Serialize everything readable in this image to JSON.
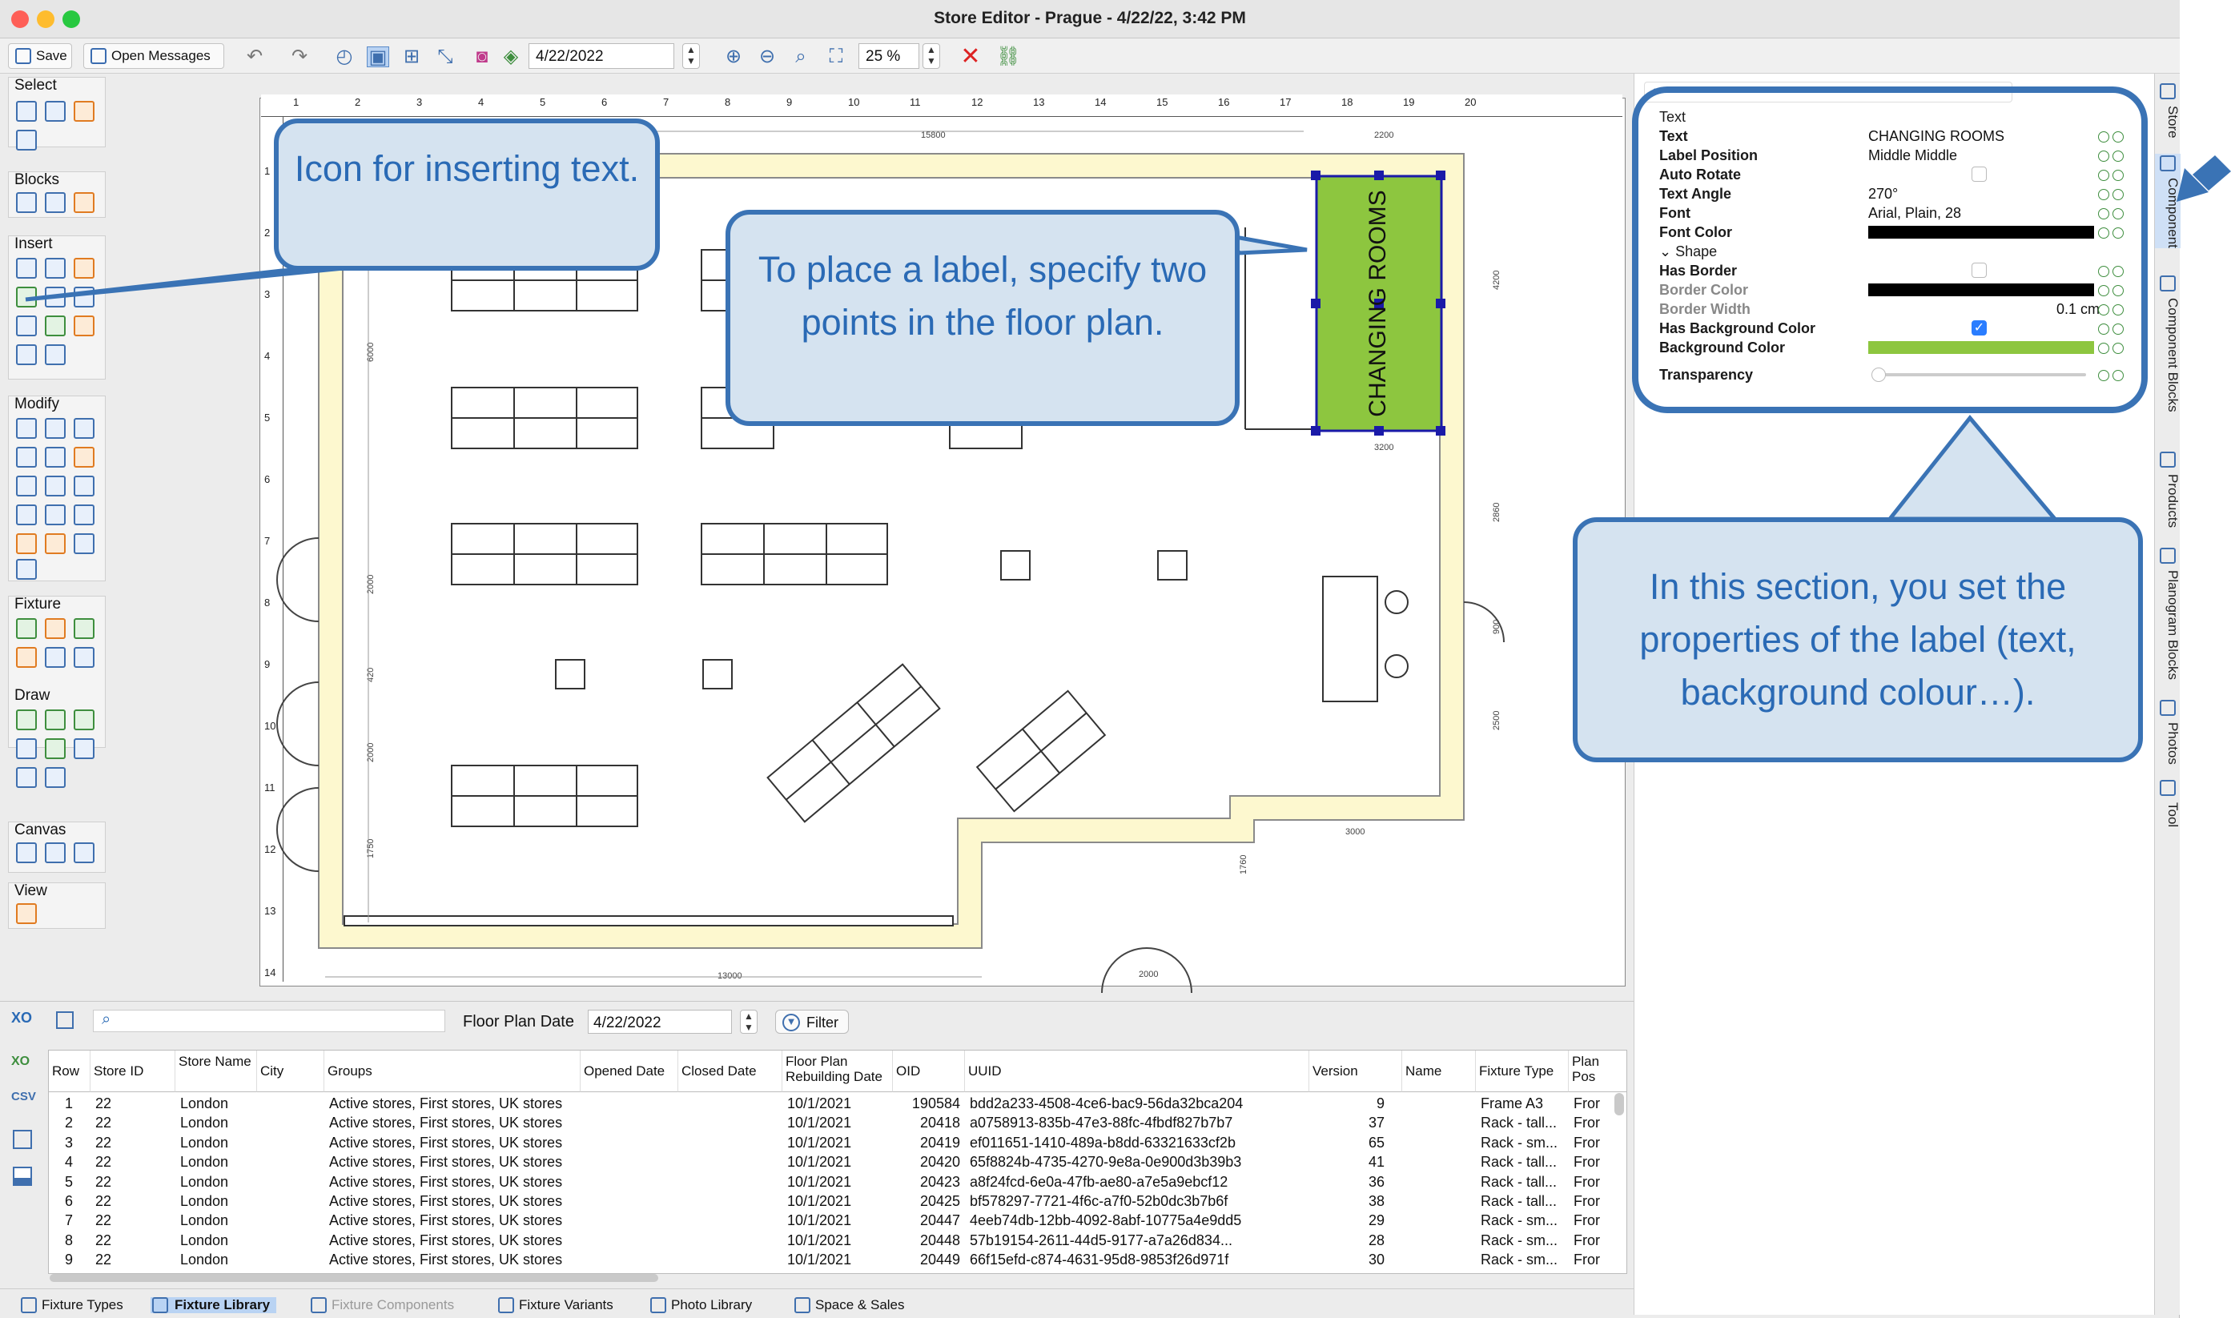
{
  "window": {
    "title": "Store Editor - Prague - 4/22/22, 3:42 PM"
  },
  "toolbar": {
    "save_label": "Save",
    "messages_label": "Open Messages",
    "date_value": "4/22/2022",
    "zoom_value": "25 %"
  },
  "palette": {
    "groups": [
      "Select",
      "Blocks",
      "Insert",
      "Modify",
      "Fixture",
      "Draw",
      "Canvas",
      "View"
    ]
  },
  "ruler": {
    "h_ticks": [
      "1",
      "2",
      "3",
      "4",
      "5",
      "6",
      "7",
      "8",
      "9",
      "10",
      "11",
      "12",
      "13",
      "14",
      "15",
      "16",
      "17",
      "18",
      "19",
      "20"
    ],
    "v_ticks": [
      "1",
      "2",
      "3",
      "4",
      "5",
      "6",
      "7",
      "8",
      "9",
      "10",
      "11",
      "12",
      "13",
      "14"
    ]
  },
  "floorplan": {
    "label_text": "CHANGING ROOMS",
    "dims": [
      "15800",
      "2200",
      "4200",
      "3200",
      "2860",
      "900",
      "2500",
      "3000",
      "2000",
      "13000",
      "1760",
      "1750",
      "2000",
      "2000",
      "420",
      "6000"
    ]
  },
  "props": {
    "section_text": "Text",
    "section_shape": "Shape",
    "rows": [
      {
        "k": "Text",
        "v": "CHANGING ROOMS"
      },
      {
        "k": "Label Position",
        "v": "Middle Middle"
      },
      {
        "k": "Auto Rotate",
        "v": ""
      },
      {
        "k": "Text Angle",
        "v": "270°"
      },
      {
        "k": "Font",
        "v": "Arial, Plain, 28"
      },
      {
        "k": "Font Color",
        "v": ""
      },
      {
        "k": "Has Border",
        "v": ""
      },
      {
        "k": "Border Color",
        "v": ""
      },
      {
        "k": "Border Width",
        "v": "0.1 cm"
      },
      {
        "k": "Has Background Color",
        "v": ""
      },
      {
        "k": "Background Color",
        "v": ""
      },
      {
        "k": "Transparency",
        "v": ""
      }
    ],
    "font_color": "#000000",
    "bg_color": "#8dc63f"
  },
  "sidetabs": [
    "Store",
    "Component",
    "Component Blocks",
    "Products",
    "Planogram Blocks",
    "Photos",
    "Tool"
  ],
  "bottom": {
    "floor_plan_date_label": "Floor Plan Date",
    "floor_plan_date_value": "4/22/2022",
    "filter_label": "Filter",
    "columns": [
      "Row",
      "Store ID",
      "Store Name",
      "City",
      "Groups",
      "Opened Date",
      "Closed Date",
      "Floor Plan Rebuilding Date",
      "OID",
      "UUID",
      "Version",
      "Name",
      "Fixture Type",
      "Plan Pos"
    ],
    "rows": [
      [
        "1",
        "22",
        "London",
        "",
        "Active stores, First stores, UK stores",
        "",
        "",
        "10/1/2021",
        "190584",
        "bdd2a233-4508-4ce6-bac9-56da32bca204",
        "9",
        "",
        "Frame A3",
        "Fror"
      ],
      [
        "2",
        "22",
        "London",
        "",
        "Active stores, First stores, UK stores",
        "",
        "",
        "10/1/2021",
        "20418",
        "a0758913-835b-47e3-88fc-4fbdf827b7b7",
        "37",
        "",
        "Rack - tall...",
        "Fror"
      ],
      [
        "3",
        "22",
        "London",
        "",
        "Active stores, First stores, UK stores",
        "",
        "",
        "10/1/2021",
        "20419",
        "ef011651-1410-489a-b8dd-63321633cf2b",
        "65",
        "",
        "Rack - sm...",
        "Fror"
      ],
      [
        "4",
        "22",
        "London",
        "",
        "Active stores, First stores, UK stores",
        "",
        "",
        "10/1/2021",
        "20420",
        "65f8824b-4735-4270-9e8a-0e900d3b39b3",
        "41",
        "",
        "Rack - tall...",
        "Fror"
      ],
      [
        "5",
        "22",
        "London",
        "",
        "Active stores, First stores, UK stores",
        "",
        "",
        "10/1/2021",
        "20423",
        "a8f24fcd-6e0a-47fb-ae80-a7e5a9ebcf12",
        "36",
        "",
        "Rack - tall...",
        "Fror"
      ],
      [
        "6",
        "22",
        "London",
        "",
        "Active stores, First stores, UK stores",
        "",
        "",
        "10/1/2021",
        "20425",
        "bf578297-7721-4f6c-a7f0-52b0dc3b7b6f",
        "38",
        "",
        "Rack - tall...",
        "Fror"
      ],
      [
        "7",
        "22",
        "London",
        "",
        "Active stores, First stores, UK stores",
        "",
        "",
        "10/1/2021",
        "20447",
        "4eeb74db-12bb-4092-8abf-10775a4e9dd5",
        "29",
        "",
        "Rack - sm...",
        "Fror"
      ],
      [
        "8",
        "22",
        "London",
        "",
        "Active stores, First stores, UK stores",
        "",
        "",
        "10/1/2021",
        "20448",
        "57b19154-2611-44d5-9177-a7a26d834...",
        "28",
        "",
        "Rack - sm...",
        "Fror"
      ],
      [
        "9",
        "22",
        "London",
        "",
        "Active stores, First stores, UK stores",
        "",
        "",
        "10/1/2021",
        "20449",
        "66f15efd-c874-4631-95d8-9853f26d971f",
        "30",
        "",
        "Rack - sm...",
        "Fror"
      ]
    ],
    "tabs": [
      "Fixture Types",
      "Fixture Library",
      "Fixture Components",
      "Fixture Variants",
      "Photo Library",
      "Space & Sales"
    ]
  },
  "callouts": {
    "insert_text": "Icon for inserting text.",
    "place_label": "To place a label, specify two points in the floor plan.",
    "properties": "In this section, you set the properties of the label (text, background colour…)."
  }
}
